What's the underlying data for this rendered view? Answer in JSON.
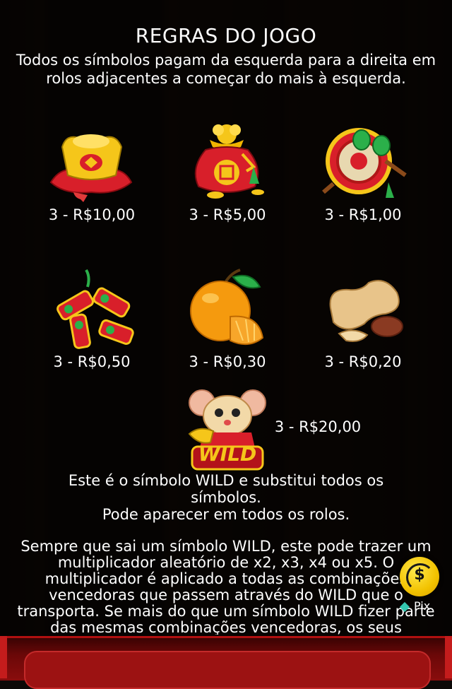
{
  "title": "REGRAS DO JOGO",
  "intro": "Todos os símbolos pagam da esquerda para a direita em rolos adjacentes a começar do mais à esquerda.",
  "symbols": [
    {
      "icon": "gold-ingot-icon",
      "payout": "3 - R$10,00"
    },
    {
      "icon": "money-bag-icon",
      "payout": "3 - R$5,00"
    },
    {
      "icon": "drum-icon",
      "payout": "3 - R$1,00"
    },
    {
      "icon": "firecracker-icon",
      "payout": "3 - R$0,50"
    },
    {
      "icon": "orange-icon",
      "payout": "3 - R$0,30"
    },
    {
      "icon": "peanut-icon",
      "payout": "3 - R$0,20"
    }
  ],
  "wild": {
    "icon": "wild-mouse-icon",
    "badge": "WILD",
    "payout": "3 - R$20,00",
    "desc_line1": "Este é o símbolo WILD e substitui todos os símbolos.",
    "desc_line2": "Pode aparecer em todos os rolos.",
    "multiplier_text": "Sempre que sai um símbolo WILD, este pode trazer um multiplicador aleatório de x2, x3, x4 ou x5. O multiplicador é aplicado a todas as combinações vencedoras que passem através do WILD que o transporta. Se mais do que um símbolo WILD fizer parte das mesmas combinações vencedoras, os seus"
  },
  "pix": {
    "label": "Pix",
    "coin_symbol": "$"
  },
  "colors": {
    "accent_red": "#9c1212",
    "gold": "#f2c200",
    "pix_teal": "#34c7b0"
  }
}
